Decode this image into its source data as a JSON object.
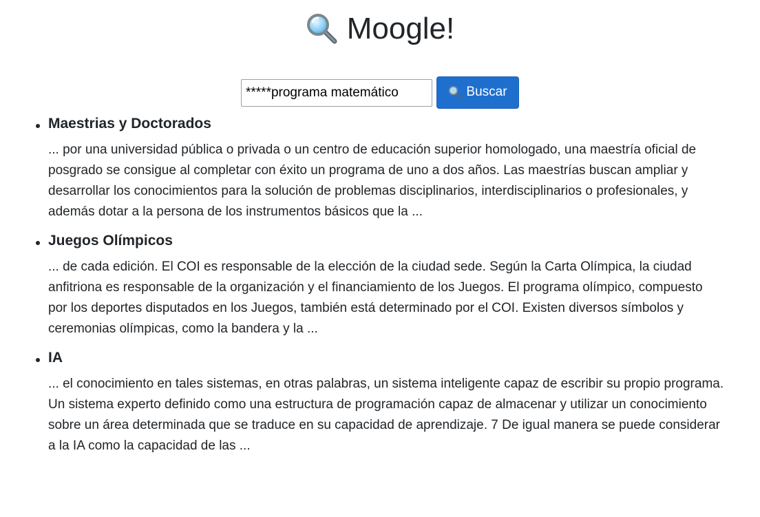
{
  "header": {
    "title": "Moogle!",
    "icon": "magnifier-icon"
  },
  "search": {
    "value": "*****programa matemático",
    "button_label": "Buscar",
    "button_icon": "magnifier-icon",
    "button_color": "#1f6fcf"
  },
  "results": [
    {
      "title": "Maestrias y Doctorados",
      "snippet": "... por una universidad pública o privada o un centro de educación superior homologado, una maestría oficial de posgrado se consigue al completar con éxito un programa de uno a dos años. Las maestrías buscan ampliar y desarrollar los conocimientos para la solución de problemas disciplinarios, interdisciplinarios o profesionales, y además dotar a la persona de los instrumentos básicos que la ..."
    },
    {
      "title": "Juegos Olímpicos",
      "snippet": "... de cada edición. El COI es responsable de la elección de la ciudad sede. Según la Carta Olímpica, la ciudad anfitriona es responsable de la organización y el financiamiento de los Juegos. El programa olímpico, compuesto por los deportes disputados en los Juegos, también está determinado por el COI. Existen diversos símbolos y ceremonias olímpicas, como la bandera y la ..."
    },
    {
      "title": "IA",
      "snippet": "... el conocimiento en tales sistemas, en otras palabras, un sistema inteligente capaz de escribir su propio programa. Un sistema experto definido como una estructura de programación capaz de almacenar y utilizar un conocimiento sobre un área determinada que se traduce en su capacidad de aprendizaje. 7 De igual manera se puede considerar a la IA como la capacidad de las ..."
    }
  ]
}
